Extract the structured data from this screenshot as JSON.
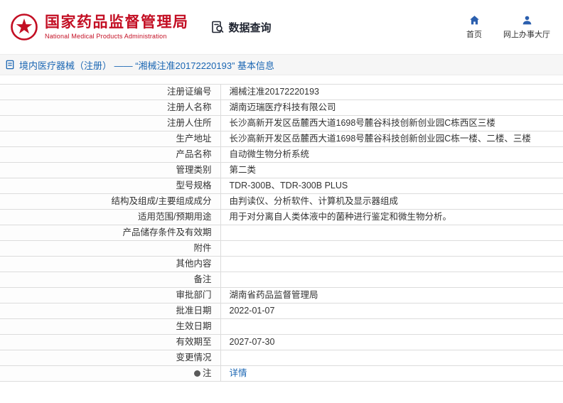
{
  "colors": {
    "brand_red": "#c30e23",
    "link_blue": "#1a66b3"
  },
  "header": {
    "org_cn": "国家药品监督管理局",
    "org_en": "National Medical Products Administration",
    "nav_query": "数据查询",
    "nav_home": "首页",
    "nav_hall": "网上办事大厅"
  },
  "breadcrumb": {
    "title": "境内医疗器械（注册） —— “湘械注准20172220193” 基本信息"
  },
  "table": {
    "rows": [
      {
        "label": "注册证编号",
        "value": "湘械注准20172220193"
      },
      {
        "label": "注册人名称",
        "value": "湖南迈瑞医疗科技有限公司"
      },
      {
        "label": "注册人住所",
        "value": "长沙高新开发区岳麓西大道1698号麓谷科技创新创业园C栋西区三楼"
      },
      {
        "label": "生产地址",
        "value": "长沙高新开发区岳麓西大道1698号麓谷科技创新创业园C栋一楼、二楼、三楼"
      },
      {
        "label": "产品名称",
        "value": "自动微生物分析系统"
      },
      {
        "label": "管理类别",
        "value": "第二类"
      },
      {
        "label": "型号规格",
        "value": "TDR-300B、TDR-300B PLUS"
      },
      {
        "label": "结构及组成/主要组成成分",
        "value": "由判读仪、分析软件、计算机及显示器组成"
      },
      {
        "label": "适用范围/预期用途",
        "value": "用于对分离自人类体液中的菌种进行鉴定和微生物分析。"
      },
      {
        "label": "产品储存条件及有效期",
        "value": ""
      },
      {
        "label": "附件",
        "value": ""
      },
      {
        "label": "其他内容",
        "value": ""
      },
      {
        "label": "备注",
        "value": ""
      },
      {
        "label": "审批部门",
        "value": "湖南省药品监督管理局"
      },
      {
        "label": "批准日期",
        "value": "2022-01-07"
      },
      {
        "label": "生效日期",
        "value": ""
      },
      {
        "label": "有效期至",
        "value": "2027-07-30"
      },
      {
        "label": "变更情况",
        "value": ""
      },
      {
        "label": "注",
        "value": "详情"
      }
    ]
  }
}
